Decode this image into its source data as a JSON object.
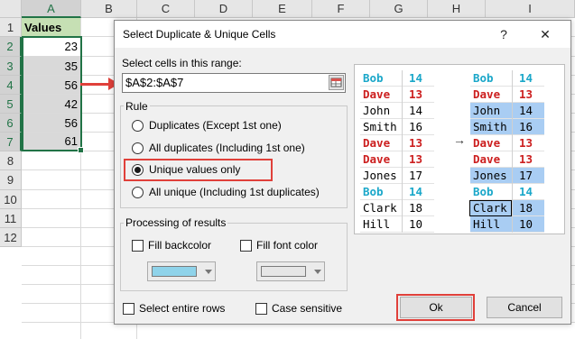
{
  "sheet": {
    "columns": [
      "A",
      "B",
      "C",
      "D",
      "E",
      "F",
      "G",
      "H",
      "I"
    ],
    "rows": [
      "1",
      "2",
      "3",
      "4",
      "5",
      "6",
      "7",
      "8",
      "9",
      "10",
      "11",
      "12"
    ],
    "header": "Values",
    "values": [
      "23",
      "35",
      "56",
      "42",
      "56",
      "61"
    ]
  },
  "dialog": {
    "title": "Select Duplicate & Unique Cells",
    "help": "?",
    "close": "✕",
    "range_label": "Select cells in this range:",
    "range_value": "$A$2:$A$7",
    "rule_label": "Rule",
    "rules": [
      {
        "label": "Duplicates (Except 1st one)",
        "selected": false
      },
      {
        "label": "All duplicates (Including 1st one)",
        "selected": false
      },
      {
        "label": "Unique values only",
        "selected": true
      },
      {
        "label": "All unique (Including 1st duplicates)",
        "selected": false
      }
    ],
    "processing_label": "Processing of results",
    "fill_backcolor_label": "Fill backcolor",
    "fill_fontcolor_label": "Fill font color",
    "backcolor_value": "#8fd3ea",
    "fontcolor_value": "#e6e6e6",
    "select_rows_label": "Select entire rows",
    "case_sensitive_label": "Case sensitive",
    "ok_label": "Ok",
    "cancel_label": "Cancel"
  },
  "preview": {
    "before": [
      {
        "name": "Bob",
        "num": "14",
        "color": "#1aa7c9"
      },
      {
        "name": "Dave",
        "num": "13",
        "color": "#cc1f1f"
      },
      {
        "name": "John",
        "num": "14",
        "color": "#000000"
      },
      {
        "name": "Smith",
        "num": "16",
        "color": "#000000"
      },
      {
        "name": "Dave",
        "num": "13",
        "color": "#cc1f1f"
      },
      {
        "name": "Dave",
        "num": "13",
        "color": "#cc1f1f"
      },
      {
        "name": "Jones",
        "num": "17",
        "color": "#000000"
      },
      {
        "name": "Bob",
        "num": "14",
        "color": "#1aa7c9"
      },
      {
        "name": "Clark",
        "num": "18",
        "color": "#000000"
      },
      {
        "name": "Hill",
        "num": "10",
        "color": "#000000"
      }
    ],
    "after": [
      {
        "name": "Bob",
        "num": "14",
        "color": "#1aa7c9",
        "highlight": false
      },
      {
        "name": "Dave",
        "num": "13",
        "color": "#cc1f1f",
        "highlight": false
      },
      {
        "name": "John",
        "num": "14",
        "color": "#000000",
        "highlight": true
      },
      {
        "name": "Smith",
        "num": "16",
        "color": "#000000",
        "highlight": true
      },
      {
        "name": "Dave",
        "num": "13",
        "color": "#cc1f1f",
        "highlight": false
      },
      {
        "name": "Dave",
        "num": "13",
        "color": "#cc1f1f",
        "highlight": false
      },
      {
        "name": "Jones",
        "num": "17",
        "color": "#000000",
        "highlight": true
      },
      {
        "name": "Bob",
        "num": "14",
        "color": "#1aa7c9",
        "highlight": false
      },
      {
        "name": "Clark",
        "num": "18",
        "color": "#000000",
        "highlight": true
      },
      {
        "name": "Hill",
        "num": "10",
        "color": "#000000",
        "highlight": true
      }
    ],
    "highlight_color": "#a9cdf3",
    "arrow": "→"
  },
  "colors": {
    "accent_green": "#217346",
    "annotation_red": "#e0403a"
  }
}
